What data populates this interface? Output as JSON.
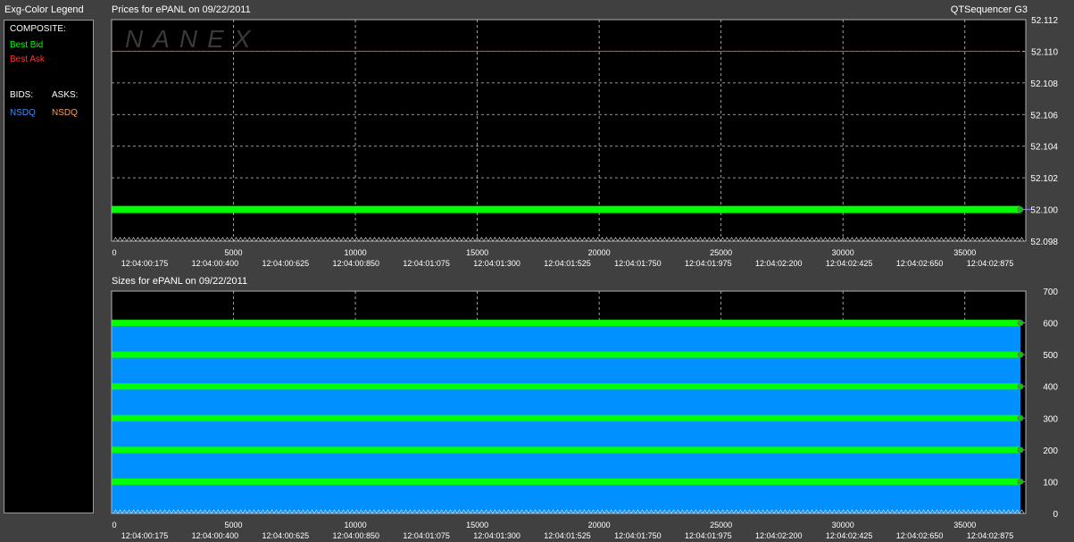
{
  "legend": {
    "title": "Exg-Color Legend",
    "composite_label": "COMPOSITE:",
    "best_bid": "Best Bid",
    "best_ask": "Best Ask",
    "bids_label": "BIDS:",
    "asks_label": "ASKS:",
    "bid_exchange": "NSDQ",
    "ask_exchange": "NSDQ",
    "colors": {
      "best_bid": "#00ff00",
      "best_ask": "#ff3333",
      "bid_nsdq": "#3c8dff",
      "ask_nsdq": "#ff9a55"
    }
  },
  "app_title": "QTSequencer G3",
  "watermark": "NANEX",
  "chart_data": [
    {
      "type": "line",
      "title": "Prices for  ePANL  on  09/22/2011",
      "xlim": [
        0,
        37500
      ],
      "x_ticks": [
        0,
        5000,
        10000,
        15000,
        20000,
        25000,
        30000,
        35000
      ],
      "x_tick_labels": [
        "0",
        "5000",
        "10000",
        "15000",
        "20000",
        "25000",
        "30000",
        "35000"
      ],
      "time_labels": [
        "12:04:00:175",
        "12:04:00:400",
        "12:04:00:625",
        "12:04:00:850",
        "12:04:01:075",
        "12:04:01:300",
        "12:04:01:525",
        "12:04:01:750",
        "12:04:01:975",
        "12:04:02:200",
        "12:04:02:425",
        "12:04:02:650",
        "12:04:02:875"
      ],
      "ylim": [
        52.098,
        52.112
      ],
      "y_ticks": [
        "52.112",
        "52.110",
        "52.108",
        "52.106",
        "52.104",
        "52.102",
        "52.100",
        "52.098"
      ],
      "grid": true,
      "series": [
        {
          "name": "Best Ask",
          "color": "#ff3333",
          "x": [
            0,
            37500
          ],
          "values": [
            52.11,
            52.11
          ]
        },
        {
          "name": "Best Bid",
          "color": "#00ff00",
          "x": [
            0,
            37500
          ],
          "values": [
            52.1,
            52.1
          ]
        }
      ],
      "current_price": 52.1
    },
    {
      "type": "area",
      "title": "Sizes for  ePANL  on  09/22/2011",
      "xlim": [
        0,
        37500
      ],
      "x_ticks": [
        0,
        5000,
        10000,
        15000,
        20000,
        25000,
        30000,
        35000
      ],
      "x_tick_labels": [
        "0",
        "5000",
        "10000",
        "15000",
        "20000",
        "25000",
        "30000",
        "35000"
      ],
      "time_labels": [
        "12:04:00:175",
        "12:04:00:400",
        "12:04:00:625",
        "12:04:00:850",
        "12:04:01:075",
        "12:04:01:300",
        "12:04:01:525",
        "12:04:01:750",
        "12:04:01:975",
        "12:04:02:200",
        "12:04:02:425",
        "12:04:02:650",
        "12:04:02:875"
      ],
      "ylim": [
        0,
        700
      ],
      "y_ticks": [
        "700",
        "600",
        "500",
        "400",
        "300",
        "200",
        "100",
        "0"
      ],
      "grid": true,
      "area_top": 600,
      "area_color": "#0090ff",
      "line_color": "#00ff00",
      "levels": [
        600,
        500,
        400,
        300,
        200,
        100
      ]
    }
  ]
}
